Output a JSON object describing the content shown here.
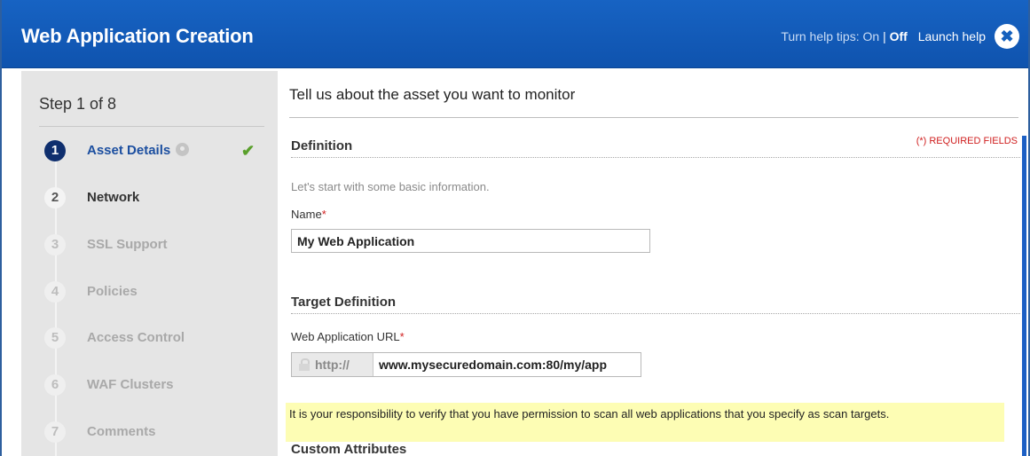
{
  "header": {
    "title": "Web Application Creation",
    "help_tips_label": "Turn help tips:",
    "help_on": "On",
    "help_separator": "|",
    "help_off": "Off",
    "launch_help": "Launch help",
    "close_glyph": "✖",
    "close_icon": "close-icon"
  },
  "sidebar": {
    "step_title": "Step 1 of 8",
    "steps": [
      {
        "number": "1",
        "label": "Asset Details",
        "state": "active",
        "completed": true
      },
      {
        "number": "2",
        "label": "Network",
        "state": "next"
      },
      {
        "number": "3",
        "label": "SSL Support",
        "state": "disabled"
      },
      {
        "number": "4",
        "label": "Policies",
        "state": "disabled"
      },
      {
        "number": "5",
        "label": "Access Control",
        "state": "disabled"
      },
      {
        "number": "6",
        "label": "WAF Clusters",
        "state": "disabled"
      },
      {
        "number": "7",
        "label": "Comments",
        "state": "disabled"
      }
    ],
    "check_glyph": "✔"
  },
  "main": {
    "heading": "Tell us about the asset you want to monitor",
    "definition": {
      "title": "Definition",
      "required_note": "(*) REQUIRED FIELDS",
      "intro": "Let's start with some basic information.",
      "name_label": "Name",
      "required_star": "*",
      "name_value": "My Web Application"
    },
    "target": {
      "title": "Target Definition",
      "url_label": "Web Application URL",
      "required_star": "*",
      "url_prefix": "http://",
      "url_value": "www.mysecuredomain.com:80/my/app"
    },
    "warning": "It is your responsibility to verify that you have permission to scan all web applications that you specify as scan targets.",
    "custom_attributes_title": "Custom Attributes"
  },
  "colors": {
    "header_blue": "#1560bd",
    "active_step": "#0f2f6e",
    "required_red": "#d02020",
    "warning_yellow": "#fdfdb4",
    "check_green": "#5aa02c"
  }
}
